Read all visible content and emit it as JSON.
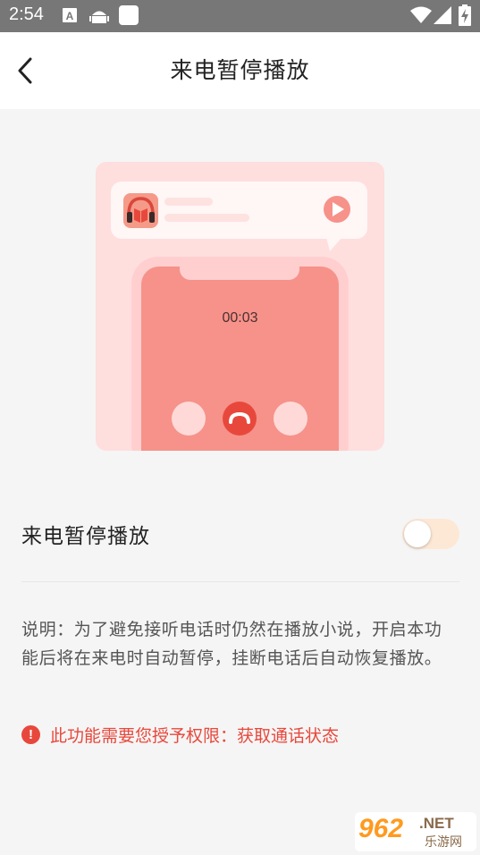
{
  "status_bar": {
    "time": "2:54",
    "icons": [
      "a-notification-icon",
      "android-robot-icon",
      "white-square-icon",
      "wifi-icon",
      "signal-icon",
      "battery-charging-icon"
    ]
  },
  "header": {
    "back_icon": "chevron-left-icon",
    "title": "来电暂停播放"
  },
  "illustration": {
    "timer": "00:03",
    "notification_icon": "headphones-book-icon",
    "play_icon": "play-icon",
    "hangup_icon": "hang-up-icon"
  },
  "setting": {
    "label": "来电暂停播放",
    "enabled": false
  },
  "description": "说明：为了避免接听电话时仍然在播放小说，开启本功能后将在来电时自动暂停，挂断电话后自动恢复播放。",
  "permission": {
    "icon": "exclamation-icon",
    "icon_glyph": "!",
    "text": "此功能需要您授予权限：获取通话状态"
  },
  "watermark": {
    "number": "962",
    "domain": ".NET",
    "site": "乐游网"
  },
  "colors": {
    "accent": "#e8483c",
    "illustration_bg": "#ffdede",
    "phone_body": "#f6928a",
    "toggle_off": "#fde8d6"
  }
}
